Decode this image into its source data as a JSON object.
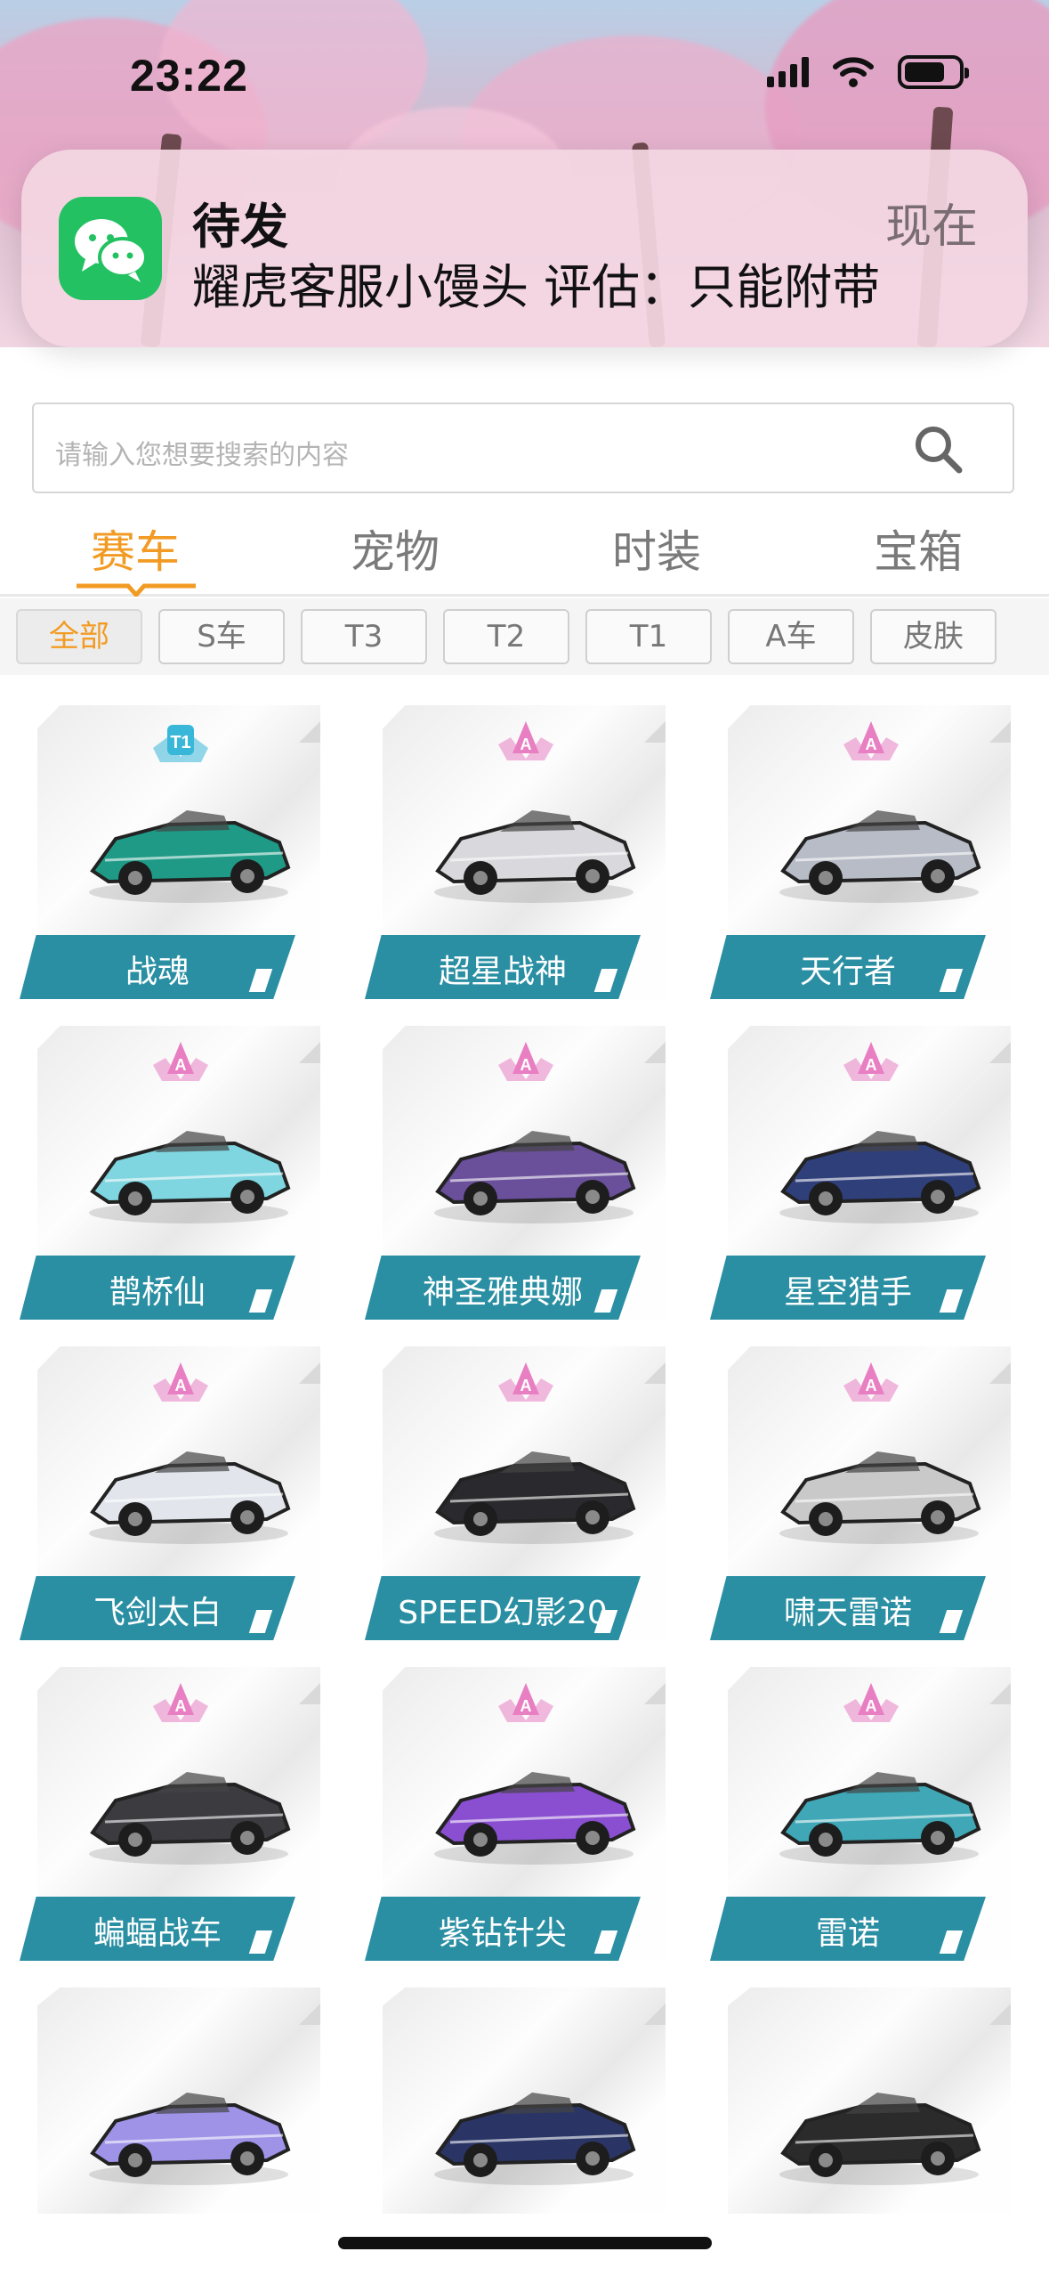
{
  "status_bar": {
    "time": "23:22"
  },
  "notification": {
    "app_icon": "wechat-icon",
    "title": "待发",
    "body": "耀虎客服小馒头 评估：只能附带",
    "time": "现在"
  },
  "search": {
    "placeholder": "请输入您想要搜索的内容",
    "icon": "search-icon"
  },
  "tabs": [
    {
      "label": "赛车",
      "active": true
    },
    {
      "label": "宠物",
      "active": false
    },
    {
      "label": "时装",
      "active": false
    },
    {
      "label": "宝箱",
      "active": false
    }
  ],
  "filters": [
    {
      "label": "全部",
      "active": true
    },
    {
      "label": "S车",
      "active": false
    },
    {
      "label": "T3",
      "active": false
    },
    {
      "label": "T2",
      "active": false
    },
    {
      "label": "T1",
      "active": false
    },
    {
      "label": "A车",
      "active": false
    },
    {
      "label": "皮肤",
      "active": false
    }
  ],
  "cars": [
    {
      "name": "战魂",
      "grade": "T1",
      "color": "#1f9a86"
    },
    {
      "name": "超星战神",
      "grade": "A",
      "color": "#d9d9dd"
    },
    {
      "name": "天行者",
      "grade": "A",
      "color": "#b7bcc6"
    },
    {
      "name": "鹊桥仙",
      "grade": "A",
      "color": "#7fd6e0"
    },
    {
      "name": "神圣雅典娜",
      "grade": "A",
      "color": "#6a4f9a"
    },
    {
      "name": "星空猎手",
      "grade": "A",
      "color": "#2f3f7a"
    },
    {
      "name": "飞剑太白",
      "grade": "A",
      "color": "#e2e6ec"
    },
    {
      "name": "SPEED幻影20",
      "grade": "A",
      "color": "#2a2a2e"
    },
    {
      "name": "啸天雷诺",
      "grade": "A",
      "color": "#c9c9c9"
    },
    {
      "name": "蝙蝠战车",
      "grade": "A",
      "color": "#3b3b40"
    },
    {
      "name": "紫钻针尖",
      "grade": "A",
      "color": "#8a4fd0"
    },
    {
      "name": "雷诺",
      "grade": "A",
      "color": "#3fa7b5"
    },
    {
      "name": "",
      "grade": "",
      "color": "#9f93e8"
    },
    {
      "name": "",
      "grade": "",
      "color": "#2a3566"
    },
    {
      "name": "",
      "grade": "",
      "color": "#2b2b2b"
    }
  ],
  "colors": {
    "accent": "#f29b24",
    "name_bar": "#2a8fa3",
    "grade_a": "#e87fc2",
    "grade_t1": "#39b7d8",
    "wechat": "#23c162"
  }
}
